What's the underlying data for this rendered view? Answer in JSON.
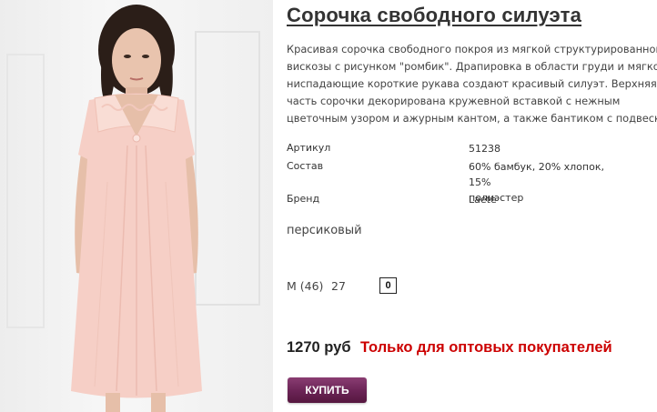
{
  "product": {
    "title": "Сорочка свободного силуэта",
    "description_lines": [
      "Красивая сорочка свободного покроя из мягкой структурированной",
      "вискозы с рисунком \"ромбик\". Драпировка в области груди и мягко",
      "ниспадающие короткие рукава создают красивый силуэт. Верхняя",
      "часть сорочки декорирована кружевной вставкой с нежным",
      "цветочным узором и ажурным кантом, а также бантиком с подвеской."
    ],
    "specs": [
      {
        "label": "Артикул",
        "value_lines": [
          "51238"
        ]
      },
      {
        "label": "Состав",
        "value_lines": [
          "60% бамбук, 20% хлопок, 15%",
          "полиэстер"
        ]
      },
      {
        "label": "Бренд",
        "value_lines": [
          "Laete"
        ]
      }
    ],
    "color": "персиковый",
    "size": {
      "label": "M (46)",
      "stock": "27",
      "quantity": "0"
    },
    "price": "1270 руб",
    "wholesale_note": "Только для оптовых покупателей",
    "buy_label": "КУПИТЬ"
  },
  "colors": {
    "title": "#333333",
    "price": "#222222",
    "wholesale_note": "#cc0000",
    "buy_button": "#6a2355",
    "dress": "#f6cfc6"
  }
}
